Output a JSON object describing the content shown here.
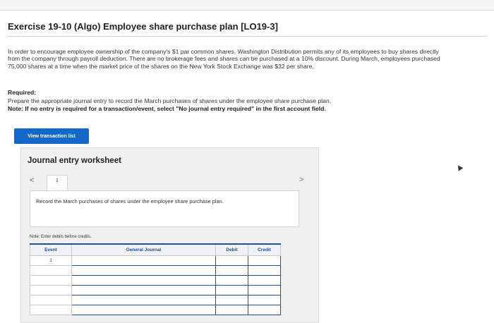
{
  "exercise": {
    "title": "Exercise 19-10 (Algo) Employee share purchase plan [LO19-3]",
    "intro": "In order to encourage employee ownership of the company's $1 par common shares, Washington Distribution permits any of its employees to buy shares directly from the company through payroll deduction. There are no brokerage fees and shares can be purchased at a 10% discount. During March, employees purchased 75,000 shares at a time when the market price of the shares on the New York Stock Exchange was $32 per share.",
    "required_heading": "Required:",
    "required_text": "Prepare the appropriate journal entry to record the March purchases of shares under the employee share purchase plan.",
    "required_note": "Note: If no entry is required for a transaction/event, select \"No journal entry required\" in the first account field."
  },
  "buttons": {
    "view_transaction_list": "View transaction list"
  },
  "worksheet": {
    "title": "Journal entry worksheet",
    "prev_glyph": "<",
    "next_glyph": ">",
    "entry_tab": "1",
    "instruction": "Record the March purchases of shares under the employee share purchase plan.",
    "note": "Note: Enter debits before credits.",
    "table": {
      "headers": [
        "Event",
        "General Journal",
        "Debit",
        "Credit"
      ],
      "rows": [
        {
          "event": "1",
          "account": "",
          "debit": "",
          "credit": ""
        },
        {
          "event": "",
          "account": "",
          "debit": "",
          "credit": ""
        },
        {
          "event": "",
          "account": "",
          "debit": "",
          "credit": ""
        },
        {
          "event": "",
          "account": "",
          "debit": "",
          "credit": ""
        },
        {
          "event": "",
          "account": "",
          "debit": "",
          "credit": ""
        },
        {
          "event": "",
          "account": "",
          "debit": "",
          "credit": ""
        }
      ]
    }
  }
}
